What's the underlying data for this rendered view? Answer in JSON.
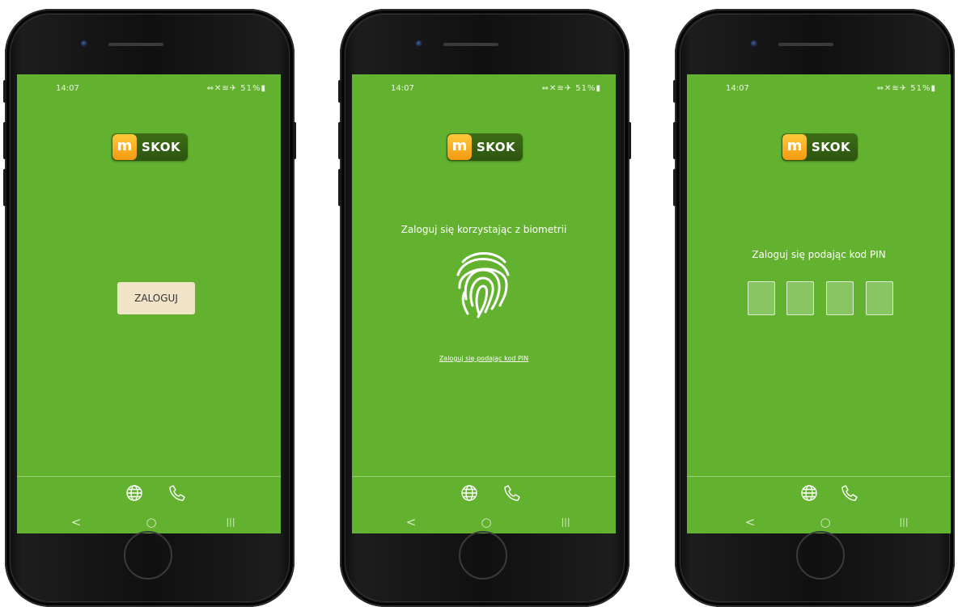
{
  "status_bar": {
    "time": "14:07",
    "indicators": "⇔✕≋✈ 51%▮"
  },
  "logo": {
    "letter": "m",
    "text": "SKOK"
  },
  "screen1": {
    "login_button": "ZALOGUJ"
  },
  "screen2": {
    "title": "Zaloguj się korzystając z biometrii",
    "pin_link": "Zaloguj się podając kod PIN"
  },
  "screen3": {
    "title": "Zaloguj się podając kod PIN",
    "pin_slots": 4
  },
  "footer": {
    "icons": [
      "globe-icon",
      "phone-icon"
    ]
  },
  "nav_bar": {
    "back": "<",
    "home": "○",
    "recents": "|||"
  },
  "colors": {
    "screen_bg": "#63b22f",
    "login_button_bg": "#f1e3c7",
    "logo_orange": "#f39a12",
    "logo_green": "#2c5410"
  }
}
